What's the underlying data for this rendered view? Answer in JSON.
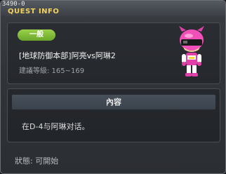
{
  "window": {
    "quest_id": "3490-0",
    "title": "QUEST INFO"
  },
  "quest": {
    "category_badge": "一般",
    "name": "[地球防御本部]阿亮vs阿琳2",
    "level_requirement": "建議等級: 165~169",
    "npc_icon": "pink-helmet-hero-icon"
  },
  "content": {
    "header": "內容",
    "text": "在D-4与阿琳对话。"
  },
  "footer": {
    "status": "狀態: 可開始"
  },
  "colors": {
    "title": "#f4d25a",
    "badge": "#7fbf35",
    "panel_bg": "#26292d"
  }
}
